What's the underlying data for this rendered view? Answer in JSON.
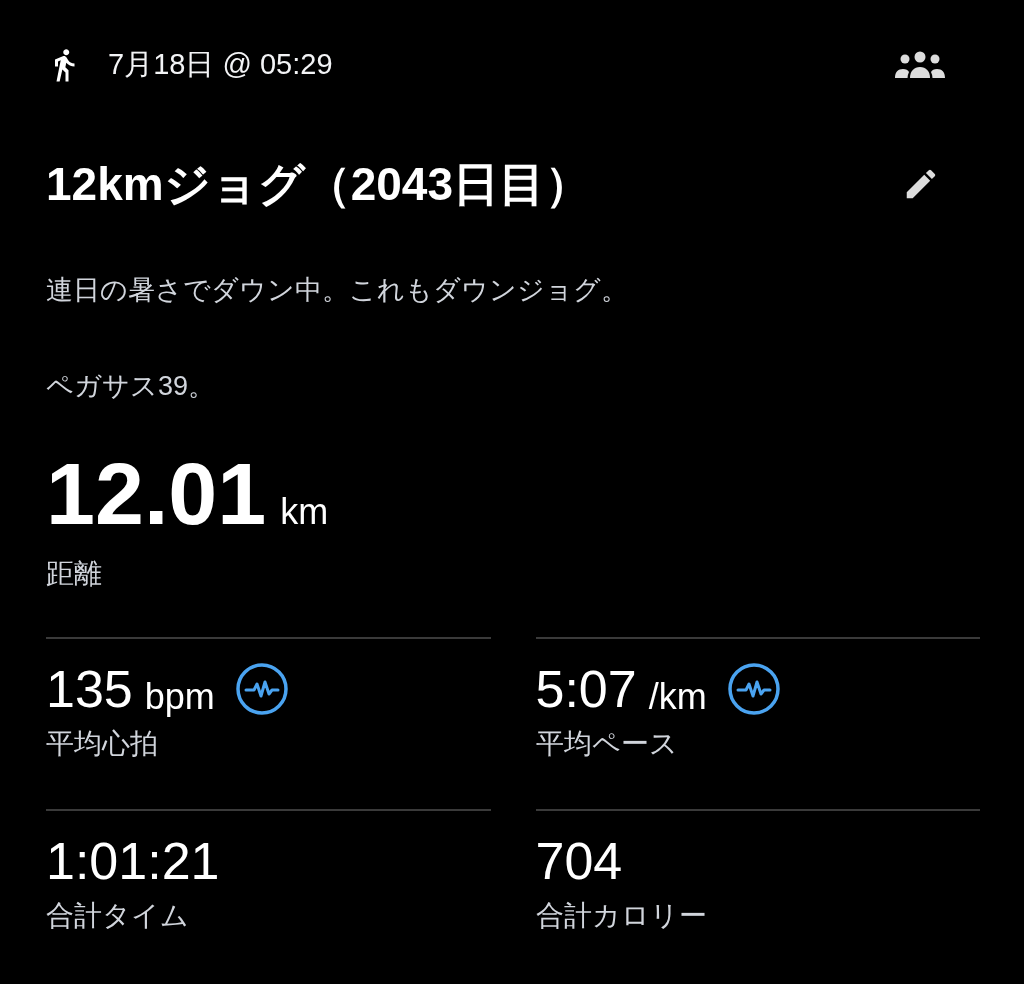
{
  "header": {
    "datetime": "7月18日 @ 05:29"
  },
  "title": "12kmジョグ（2043日目）",
  "description": [
    "連日の暑さでダウン中。これもダウンジョグ。",
    "ペガサス39。"
  ],
  "distance": {
    "value": "12.01",
    "unit": "km",
    "label": "距離"
  },
  "stats": [
    {
      "value": "135",
      "unit": "bpm",
      "label": "平均心拍",
      "chart_icon": true
    },
    {
      "value": "5:07",
      "unit": "/km",
      "label": "平均ペース",
      "chart_icon": true
    },
    {
      "value": "1:01:21",
      "label": "合計タイム",
      "chart_icon": false
    },
    {
      "value": "704",
      "label": "合計カロリー",
      "chart_icon": false
    }
  ]
}
